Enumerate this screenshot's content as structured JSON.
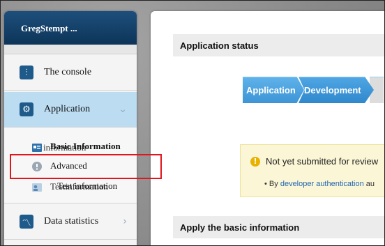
{
  "sidebar": {
    "header": "GregStempt ...",
    "items": [
      {
        "label": "The console",
        "icon": "console-icon"
      },
      {
        "label": "Application",
        "icon": "gear-icon",
        "expanded": true
      },
      {
        "label": "Data statistics",
        "icon": "chart-icon"
      }
    ],
    "sub_items": [
      {
        "label": "Basic Information",
        "overlap_label": "information",
        "icon": "id-card-icon"
      },
      {
        "label": "Advanced",
        "icon": "info-circle-icon",
        "highlighted": true
      },
      {
        "label": "Test information",
        "overlap_label": "Testinformation",
        "icon": "users-icon"
      }
    ]
  },
  "main": {
    "application_status": "Application status",
    "steps": [
      "Application",
      "Development"
    ],
    "notice": {
      "title": "Not yet submitted for review",
      "sub_prefix": "By",
      "sub_link": "developer authentication",
      "sub_suffix": "au"
    },
    "apply_header": "Apply the basic information"
  },
  "colors": {
    "accent": "#1e5a8a",
    "active_bg": "#bcdcf2",
    "highlight": "#e3141b",
    "step": "#3d95d6"
  }
}
